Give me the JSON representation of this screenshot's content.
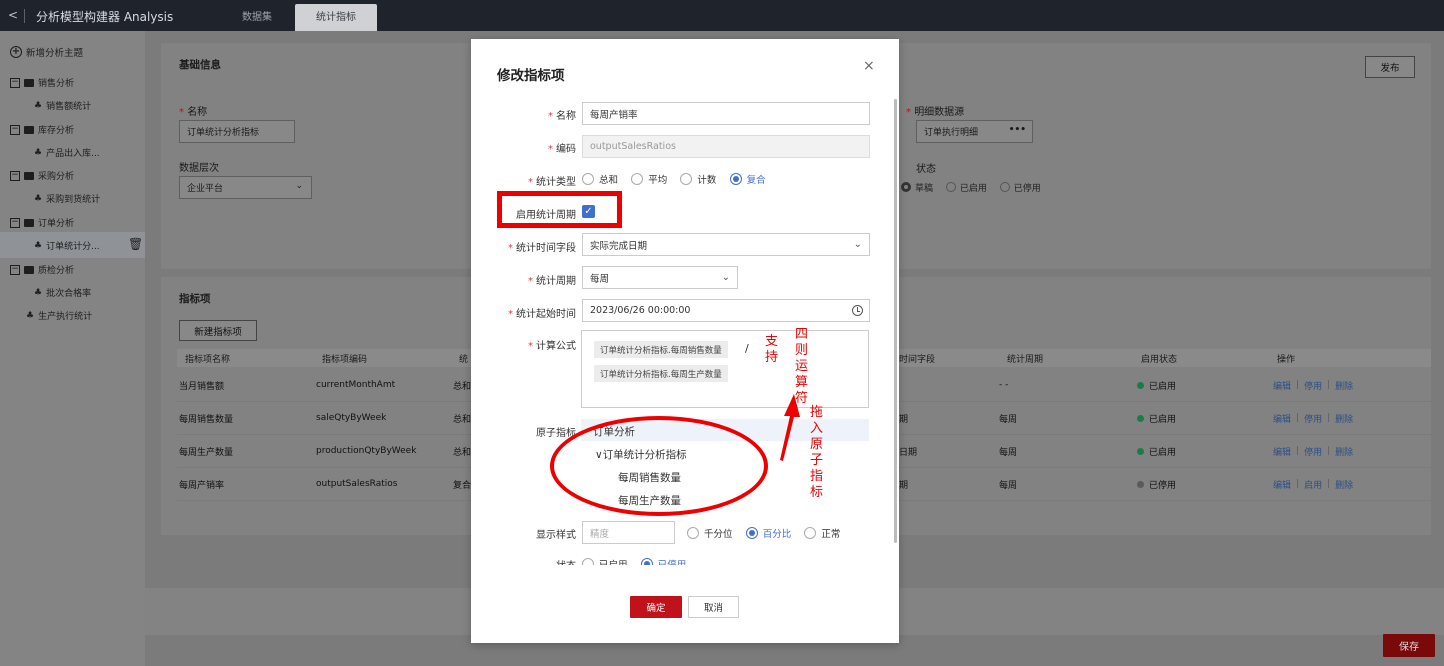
{
  "app": {
    "title": "分析模型构建器 Analysis",
    "tabs": [
      "数据集",
      "统计指标"
    ]
  },
  "sidebar": {
    "new_topic": "新增分析主题",
    "tree": [
      {
        "label": "销售分析",
        "child": "销售额统计"
      },
      {
        "label": "库存分析",
        "child": "产品出入库..."
      },
      {
        "label": "采购分析",
        "child": "采购到货统计"
      },
      {
        "label": "订单分析",
        "child": "订单统计分..."
      },
      {
        "label": "质检分析",
        "child": "批次合格率"
      }
    ],
    "standalone": "生产执行统计"
  },
  "basic": {
    "title": "基础信息",
    "publish": "发布",
    "name_label": "名称",
    "name_value": "订单统计分析指标",
    "level_label": "数据层次",
    "level_value": "企业平台",
    "detail_source_label": "明细数据源",
    "detail_source_value": "订单执行明细",
    "status_label": "状态",
    "status_options": [
      "草稿",
      "已启用",
      "已停用"
    ]
  },
  "indicators": {
    "title": "指标项",
    "new_button": "新建指标项",
    "columns": [
      "指标项名称",
      "指标项编码",
      "统",
      "时间字段",
      "统计周期",
      "启用状态",
      "操作"
    ],
    "rows": [
      {
        "name": "当月销售额",
        "code": "currentMonthAmt",
        "type": "总和",
        "time_field": "",
        "period": "- -",
        "status": "已启用",
        "status_color": "#1f7a4a",
        "ops": [
          "编辑",
          "停用",
          "删除"
        ]
      },
      {
        "name": "每周销售数量",
        "code": "saleQtyByWeek",
        "type": "总和",
        "time_field": "期",
        "period": "每周",
        "status": "已启用",
        "status_color": "#1f7a4a",
        "ops": [
          "编辑",
          "停用",
          "删除"
        ]
      },
      {
        "name": "每周生产数量",
        "code": "productionQtyByWeek",
        "type": "总和",
        "time_field": "日期",
        "period": "每周",
        "status": "已启用",
        "status_color": "#1f7a4a",
        "ops": [
          "编辑",
          "停用",
          "删除"
        ]
      },
      {
        "name": "每周产销率",
        "code": "outputSalesRatios",
        "type": "复合",
        "time_field": "期",
        "period": "每周",
        "status": "已停用",
        "status_color": "#5a5a5a",
        "ops": [
          "编辑",
          "启用",
          "删除"
        ]
      }
    ]
  },
  "save": "保存",
  "modal": {
    "title": "修改指标项",
    "close": "×",
    "name_label": "名称",
    "name_value": "每周产销率",
    "code_label": "编码",
    "code_value": "outputSalesRatios",
    "type_label": "统计类型",
    "type_options": [
      "总和",
      "平均",
      "计数",
      "复合"
    ],
    "enable_period_label": "启用统计周期",
    "time_field_label": "统计时间字段",
    "time_field_value": "实际完成日期",
    "period_label": "统计周期",
    "period_value": "每周",
    "start_label": "统计起始时间",
    "start_value": "2023/06/26 00:00:00",
    "formula_label": "计算公式",
    "formula_tags": [
      "订单统计分析指标.每周销售数量",
      "订单统计分析指标.每周生产数量"
    ],
    "formula_operator": "/",
    "atomic_label": "原子指标",
    "atomic_tree": {
      "group": "订单分析",
      "node": "订单统计分析指标",
      "items": [
        "每周销售数量",
        "每周生产数量"
      ]
    },
    "display_label": "显示样式",
    "precision_placeholder": "精度",
    "display_options": [
      "千分位",
      "百分比",
      "正常"
    ],
    "status_label": "状态",
    "status_options": [
      "已启用",
      "已停用"
    ],
    "ok": "确定",
    "cancel": "取消"
  },
  "annotations": {
    "support": "支持",
    "ops": "四则运算符",
    "drag": "拖入原子指标"
  },
  "colors": {
    "primary": "#c1121c",
    "accent": "#3f6fd1",
    "annotation": "#ee0000"
  }
}
